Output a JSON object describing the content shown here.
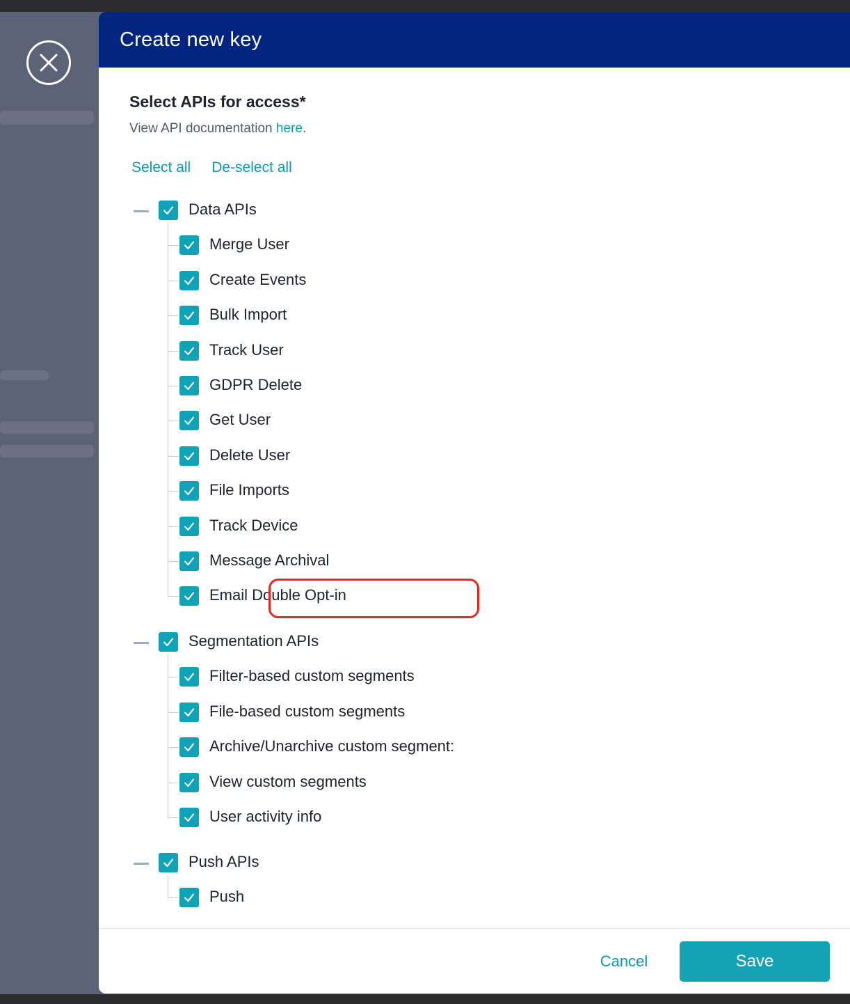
{
  "modal": {
    "title": "Create new key",
    "section_title": "Select APIs for access*",
    "doc_prefix": "View API documentation ",
    "doc_link": "here",
    "doc_suffix": ".",
    "select_all": "Select all",
    "deselect_all": "De-select all",
    "cancel": "Cancel",
    "save": "Save"
  },
  "groups": [
    {
      "label": "Data APIs",
      "checked": true,
      "items": [
        {
          "label": "Merge User",
          "checked": true
        },
        {
          "label": "Create Events",
          "checked": true
        },
        {
          "label": "Bulk Import",
          "checked": true
        },
        {
          "label": "Track User",
          "checked": true
        },
        {
          "label": "GDPR Delete",
          "checked": true
        },
        {
          "label": "Get User",
          "checked": true
        },
        {
          "label": "Delete User",
          "checked": true
        },
        {
          "label": "File Imports",
          "checked": true
        },
        {
          "label": "Track Device",
          "checked": true
        },
        {
          "label": "Message Archival",
          "checked": true
        },
        {
          "label": "Email Double Opt-in",
          "checked": true
        }
      ]
    },
    {
      "label": "Segmentation APIs",
      "checked": true,
      "items": [
        {
          "label": "Filter-based custom segments",
          "checked": true
        },
        {
          "label": "File-based custom segments",
          "checked": true
        },
        {
          "label": "Archive/Unarchive custom segment:",
          "checked": true
        },
        {
          "label": "View custom segments",
          "checked": true
        },
        {
          "label": "User activity info",
          "checked": true
        }
      ]
    },
    {
      "label": "Push APIs",
      "checked": true,
      "items": [
        {
          "label": "Push",
          "checked": true
        }
      ]
    }
  ],
  "colors": {
    "header": "#022680",
    "accent": "#0fa3b8",
    "highlight": "#e8281e"
  }
}
